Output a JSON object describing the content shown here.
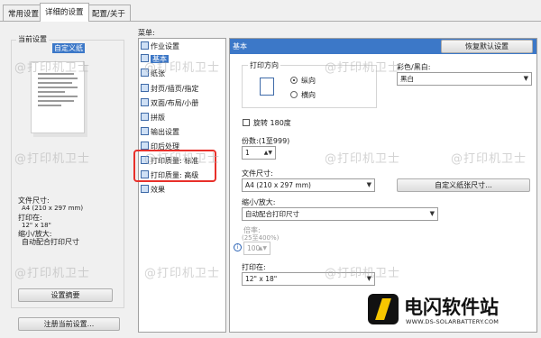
{
  "tabs": [
    {
      "label": "常用设置",
      "active": false
    },
    {
      "label": "详细的设置",
      "active": true
    },
    {
      "label": "配置/关于",
      "active": false
    }
  ],
  "left": {
    "current_settings_legend": "当前设置",
    "preview_caption": "自定义纸",
    "summary": {
      "paper_size_label": "文件尺寸:",
      "paper_size_value": "A4 (210 x 297 mm)",
      "print_on_label": "打印在:",
      "print_on_value": "12\" x 18\"",
      "scaling_label": "缩小/放大:",
      "scaling_value": "自动配合打印尺寸"
    },
    "settings_summary_button": "设置摘要",
    "register_button": "注册当前设置..."
  },
  "menu": {
    "label": "菜单:",
    "items": [
      {
        "label": "作业设置",
        "icon": "job-settings-icon",
        "selected": false
      },
      {
        "label": "基本",
        "icon": "basic-icon",
        "selected": true
      },
      {
        "label": "纸张",
        "icon": "paper-icon",
        "selected": false
      },
      {
        "label": "封页/插页/指定",
        "icon": "cover-icon",
        "selected": false
      },
      {
        "label": "双面/布局/小册",
        "icon": "duplex-icon",
        "selected": false
      },
      {
        "label": "拼版",
        "icon": "imposition-icon",
        "selected": false
      },
      {
        "label": "输出设置",
        "icon": "output-icon",
        "selected": false
      },
      {
        "label": "印后处理",
        "icon": "finishing-icon",
        "selected": false
      },
      {
        "label": "打印质量: 标准",
        "icon": "quality-icon",
        "selected": false
      },
      {
        "label": "打印质量: 高级",
        "icon": "quality-advanced-icon",
        "selected": false
      },
      {
        "label": "效果",
        "icon": "effects-icon",
        "selected": false
      }
    ]
  },
  "pane": {
    "header": "基本",
    "restore_button": "恢复默认设置",
    "orientation": {
      "legend": "打印方向",
      "portrait": "纵向",
      "landscape": "横向",
      "selected": "portrait"
    },
    "color": {
      "label": "彩色/黑白:",
      "value": "黑白"
    },
    "rotate_180": {
      "label": "旋转 180度",
      "checked": false
    },
    "copies": {
      "label": "份数:(1至999)",
      "value": "1"
    },
    "paper_size": {
      "label": "文件尺寸:",
      "value": "A4 (210 x 297 mm)"
    },
    "custom_paper_button": "自定义纸张尺寸...",
    "scaling": {
      "label": "缩小/放大:",
      "value": "自动配合打印尺寸"
    },
    "zoom": {
      "label": "倍率:",
      "range": "(25至400%)",
      "value": "100"
    },
    "print_on": {
      "label": "打印在:",
      "value": "12\" x 18\""
    }
  },
  "watermark_text": "@打印机卫士",
  "brand": {
    "name": "电闪软件站",
    "url": "WWW.DS-SOLARBATTERY.COM"
  },
  "colors": {
    "accent": "#3c78c8",
    "highlight": "#e8302a"
  }
}
